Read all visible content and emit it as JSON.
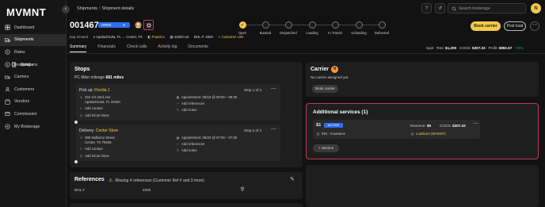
{
  "app": {
    "logo": "MVMNT"
  },
  "breadcrumb": {
    "root": "Shipments",
    "separator": "/",
    "current": "Shipment details"
  },
  "search": {
    "placeholder": "Search brokerage"
  },
  "user": {
    "avatar_initial": "N"
  },
  "sidebar": {
    "items": [
      {
        "label": "Dashboard",
        "icon": "dashboard-icon"
      },
      {
        "label": "Shipments",
        "icon": "truck-icon",
        "active": true
      },
      {
        "label": "Rates",
        "icon": "dollar-icon"
      },
      {
        "label": "Quotes",
        "icon": "quote-icon",
        "sub": true
      },
      {
        "label": "RateLens",
        "icon": "lens-icon",
        "sub": true
      },
      {
        "label": "Invoicing",
        "icon": "invoice-icon"
      },
      {
        "label": "Carriers",
        "icon": "carrier-icon"
      },
      {
        "label": "Customers",
        "icon": "customers-icon"
      },
      {
        "label": "Vendors",
        "icon": "vendors-icon"
      },
      {
        "label": "Commission",
        "icon": "commission-icon"
      },
      {
        "label": "My Brokerage",
        "icon": "brokerage-icon"
      }
    ]
  },
  "header": {
    "shipment_id": "001467",
    "status": "OPEN",
    "meta": {
      "mode": "Exp Ground",
      "origin": "Apalachicola, FL",
      "arrow": "→",
      "destination": "Center, TX",
      "customer": "PepsiCo",
      "weight": "42000 LB",
      "bol": "BOL #: 4500",
      "link": "Customer Link"
    },
    "actions": {
      "book_carrier": "Book carrier",
      "post_load": "Post load",
      "more": "⋯"
    }
  },
  "progress": {
    "steps": [
      "Open",
      "Booked",
      "Dispatched",
      "Loading",
      "In Transit",
      "Unloading",
      "Delivered"
    ],
    "completed": 1
  },
  "tabs": [
    "Summary",
    "Financials",
    "Check calls",
    "Activity log",
    "Documents"
  ],
  "financials": {
    "spot_label": "Spot",
    "rev_label": "Rev:",
    "rev": "$1,200",
    "cogs_label": "COGS:",
    "cogs": "$307.33",
    "profit_label": "Profit:",
    "profit": "$892.67",
    "margin": "↑74%"
  },
  "stops": {
    "title": "Stops",
    "mileage_label": "PC Miler mileage",
    "mileage": "681 miles",
    "cards": [
      {
        "type": "Pick up:",
        "location": "Florida 1",
        "counter": "Stop 1 of 2",
        "address1": "334 1/2 23rd Ave",
        "address2": "Apalachicola, FL 32320",
        "add_contact": "Add contact",
        "add_hours": "Add in/out times",
        "appointment": "Appointment: 06/18 @ 09:00 – 09:00",
        "add_refs": "Add references",
        "add_notes": "Add notes"
      },
      {
        "type": "Delivery:",
        "location": "Center Store",
        "counter": "Stop 2 of 2",
        "address1": "395 Mulberry Street",
        "address2": "Center, TX 75935",
        "add_contact": "Add contact",
        "add_hours": "Add in/out times",
        "appointment": "Appointment: 06/20 @ 07:00 – 07:00",
        "add_refs": "Add references",
        "add_notes": "Add notes"
      }
    ]
  },
  "references": {
    "title": "References",
    "warning": "Missing 4 references (Customer Ref # and 3 more)",
    "rows": [
      {
        "label": "BOL #",
        "value": "4500"
      }
    ]
  },
  "carrier": {
    "title": "Carrier",
    "badge": "N",
    "empty": "No carrier assigned yet.",
    "book_button": "Book carrier"
  },
  "services": {
    "title": "Additional services (1)",
    "items": [
      {
        "code": "S1",
        "status": "ACTIVE",
        "revenue_label": "Revenue:",
        "revenue": "$0",
        "cogs_label": "COGS:",
        "cogs": "$307.33",
        "name": "INS - Insurance",
        "vendor": "Loadsure (MVMNT)"
      }
    ],
    "add_button": "+ Service"
  },
  "colors": {
    "accent": "#f2c94c",
    "blue": "#2d6ff0",
    "highlight": "#c0395a",
    "green": "#27ae60"
  }
}
